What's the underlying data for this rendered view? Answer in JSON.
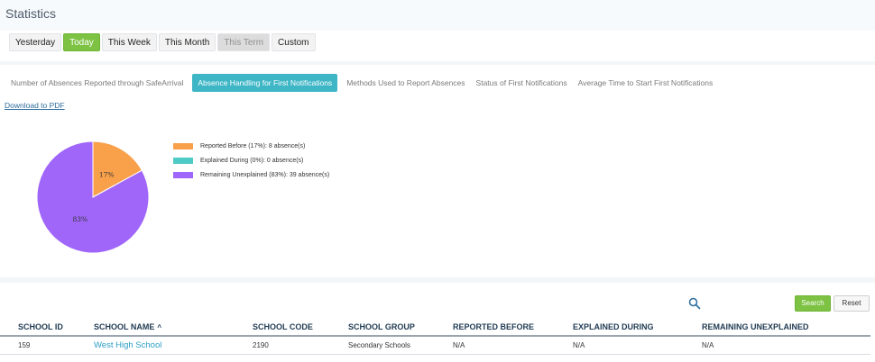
{
  "page": {
    "title": "Statistics"
  },
  "periods": [
    {
      "label": "Yesterday",
      "state": "normal"
    },
    {
      "label": "Today",
      "state": "active"
    },
    {
      "label": "This Week",
      "state": "normal"
    },
    {
      "label": "This Month",
      "state": "normal"
    },
    {
      "label": "This Term",
      "state": "disabled"
    },
    {
      "label": "Custom",
      "state": "normal"
    }
  ],
  "report_tabs": [
    {
      "label": "Number of Absences Reported through SafeArrival",
      "active": false
    },
    {
      "label": "Absence Handling for First Notifications",
      "active": true
    },
    {
      "label": "Methods Used to Report Absences",
      "active": false
    },
    {
      "label": "Status of First Notifications",
      "active": false
    },
    {
      "label": "Average Time to Start First Notifications",
      "active": false
    }
  ],
  "download_label": "Download to PDF",
  "chart_data": {
    "type": "pie",
    "slices": [
      {
        "label": "Reported Before",
        "percent": 17,
        "count": 8,
        "color": "#f9a04b",
        "slice_label": "17%"
      },
      {
        "label": "Explained During",
        "percent": 0,
        "count": 0,
        "color": "#4ecbc7",
        "slice_label": ""
      },
      {
        "label": "Remaining Unexplained",
        "percent": 83,
        "count": 39,
        "color": "#a066f9",
        "slice_label": "83%"
      }
    ],
    "legend": [
      "Reported Before (17%): 8 absence(s)",
      "Explained During (0%): 0 absence(s)",
      "Remaining Unexplained (83%): 39 absence(s)"
    ],
    "legend_position": "right"
  },
  "search": {
    "placeholder": "",
    "value": "",
    "search_label": "Search",
    "reset_label": "Reset"
  },
  "table": {
    "headers": [
      "SCHOOL ID",
      "SCHOOL NAME",
      "SCHOOL CODE",
      "SCHOOL GROUP",
      "REPORTED BEFORE",
      "EXPLAINED DURING",
      "REMAINING UNEXPLAINED"
    ],
    "sort_indicator": "^",
    "rows": [
      [
        "159",
        "West High School",
        "2190",
        "Secondary Schools",
        "N/A",
        "N/A",
        "N/A"
      ]
    ]
  },
  "colors": {
    "accent_green": "#7dc242",
    "accent_teal": "#3eb6c6",
    "link_blue": "#2a9fc4"
  }
}
